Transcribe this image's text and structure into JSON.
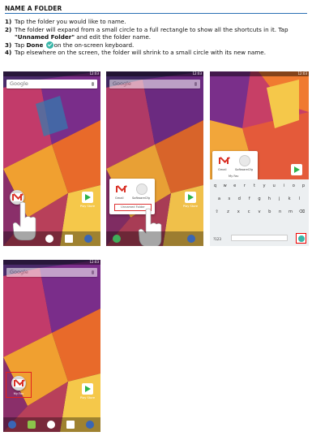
{
  "header": {
    "title": "NAME A FOLDER"
  },
  "steps": [
    {
      "num": "1)",
      "text": "Tap the folder you would like to name."
    },
    {
      "num": "2)",
      "text_a": "The folder will expand from a small circle to a full rectangle to show all the shortcuts in it. Tap ",
      "bold": "\"Unnamed Folder\"",
      "text_b": " and edit the folder name."
    },
    {
      "num": "3)",
      "text_a": "Tap ",
      "bold": "Done",
      "text_b": "on the on-screen keyboard."
    },
    {
      "num": "4)",
      "text": "Tap elsewhere on the screen, the folder will shrink to a small circle with its new name."
    }
  ],
  "screens": {
    "search_label": "Google",
    "status_time": "12:03",
    "play_store_label": "Play Store",
    "gmail_label": "Gmail",
    "softwarecfg_label": "SoftwareCfg",
    "unnamed_folder_label": "Unnamed Folder",
    "my_fav_label": "My Fav",
    "keyboard": {
      "row1": [
        "q",
        "w",
        "e",
        "r",
        "t",
        "y",
        "u",
        "i",
        "o",
        "p"
      ],
      "row2": [
        "a",
        "s",
        "d",
        "f",
        "g",
        "h",
        "j",
        "k",
        "l"
      ],
      "row3": [
        "z",
        "x",
        "c",
        "v",
        "b",
        "n",
        "m"
      ],
      "symbols_key": "?123"
    }
  },
  "colors": {
    "accent_rule": "#2a6fb4",
    "highlight": "#e02020",
    "done_icon": "#38b6a8"
  }
}
